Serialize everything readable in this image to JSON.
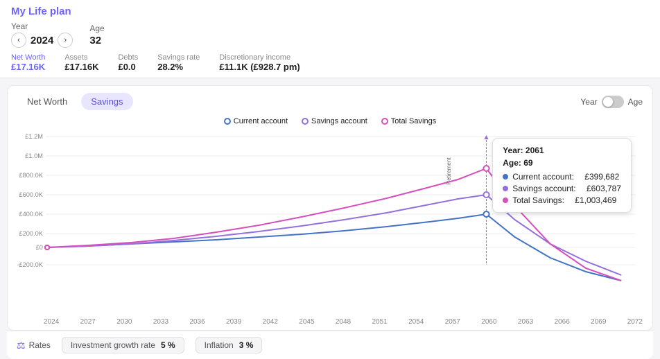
{
  "app": {
    "title": "My Life plan",
    "more_icon": "···"
  },
  "header": {
    "year_label": "Year",
    "year_value": "2024",
    "age_label": "Age",
    "age_value": "32",
    "prev_icon": "‹",
    "next_icon": "›"
  },
  "stats": {
    "net_worth_label": "Net Worth",
    "net_worth_value": "£17.16K",
    "assets_label": "Assets",
    "assets_value": "£17.16K",
    "debts_label": "Debts",
    "debts_value": "£0.0",
    "savings_rate_label": "Savings rate",
    "savings_rate_value": "28.2%",
    "discretionary_label": "Discretionary income",
    "discretionary_value": "£11.1K (£928.7 pm)"
  },
  "tabs": {
    "net_worth": "Net Worth",
    "savings": "Savings"
  },
  "toggle": {
    "year_label": "Year",
    "age_label": "Age"
  },
  "legend": {
    "current_account": "Current account",
    "savings_account": "Savings account",
    "total_savings": "Total Savings"
  },
  "tooltip": {
    "year_label": "Year:",
    "year_value": "2061",
    "age_label": "Age:",
    "age_value": "69",
    "current_account_label": "Current account:",
    "current_account_value": "£399,682",
    "savings_account_label": "Savings account:",
    "savings_account_value": "£603,787",
    "total_savings_label": "Total Savings:",
    "total_savings_value": "£1,003,469"
  },
  "x_axis": [
    "2024",
    "2027",
    "2030",
    "2033",
    "2036",
    "2039",
    "2042",
    "2045",
    "2048",
    "2051",
    "2054",
    "2057",
    "2060",
    "2063",
    "2066",
    "2069",
    "2072"
  ],
  "y_axis": [
    "£1.2M",
    "£1.0M",
    "£800.0K",
    "£600.0K",
    "£400.0K",
    "£200.0K",
    "£0",
    "−£200.0K"
  ],
  "bottom": {
    "rates_label": "Rates",
    "rates_icon": "⚖",
    "investment_growth_label": "Investment growth rate",
    "investment_growth_value": "5 %",
    "inflation_label": "Inflation",
    "inflation_value": "3 %"
  },
  "colors": {
    "current_account": "#4472c4",
    "savings_account": "#9370db",
    "total_savings": "#d64fbd",
    "accent": "#6c63ff"
  }
}
